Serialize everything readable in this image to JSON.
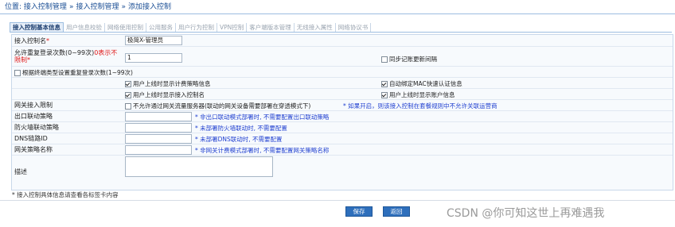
{
  "breadcrumb": {
    "prefix": "位置:",
    "items": [
      "接入控制管理",
      "接入控制管理",
      "添加接入控制"
    ]
  },
  "tabs": [
    {
      "label": "接入控制基本信息",
      "active": true
    },
    {
      "label": "用户信息校验"
    },
    {
      "label": "网络使用控制"
    },
    {
      "label": "公用服务"
    },
    {
      "label": "用户行为控制"
    },
    {
      "label": "VPN控制"
    },
    {
      "label": "客户端版本管理"
    },
    {
      "label": "无线接入属性"
    },
    {
      "label": "网络协议书"
    }
  ],
  "form": {
    "name_label": "接入控制名",
    "name_value": "极简X-管理员",
    "repeat_login_label": "允许重复登录次数(0~99次)",
    "repeat_login_zero_hint": "0表示不限制",
    "repeat_login_value": "1",
    "sync_checkbox": {
      "label": "同步记账更新间隔",
      "checked": false
    },
    "terminal_type_checkbox": {
      "label": "根据终端类型设置重复登录次数(1~99次)",
      "checked": false
    },
    "options": [
      {
        "label": "用户上线时显示计费策略信息",
        "checked": true
      },
      {
        "label": "自动绑定MAC快速认证信息",
        "checked": true
      },
      {
        "label": "用户上线时显示接入控制名",
        "checked": true
      },
      {
        "label": "用户上线时显示账户信息",
        "checked": true
      }
    ],
    "gateway_limit_label": "网关接入限制",
    "gateway_limit_checkbox": {
      "label": "不允许通过网关流量服务器(联动的网关设备需要部署在穿透模式下)",
      "checked": false
    },
    "gateway_limit_hint": "* 如果开启，则该接入控制在套餐规则中不允许关联运营商",
    "outlet_label": "出口联动策略",
    "outlet_hint": "* 非出口联动模式部署时, 不需要配置出口联动策略",
    "firewall_label": "防火墙联动策略",
    "firewall_hint": "* 未部署防火墙联动时, 不需要配置",
    "dns_label": "DNS链路ID",
    "dns_hint": "* 未部署DNS联动时, 不需要配置",
    "gateway_policy_label": "网关策略名称",
    "gateway_policy_hint": "* 非网关计费模式部署时, 不需要配置网关策略名称",
    "desc_label": "描述"
  },
  "footnote": "* 接入控制具体信息请查看各标签卡内容",
  "buttons": {
    "save": "保存",
    "back": "返回"
  },
  "watermark": "CSDN @你可知这世上再难遇我",
  "colors": {
    "link": "#1b4f95",
    "hint": "#1f3fd0",
    "required": "#e01919",
    "button": "#2e6fbc"
  }
}
